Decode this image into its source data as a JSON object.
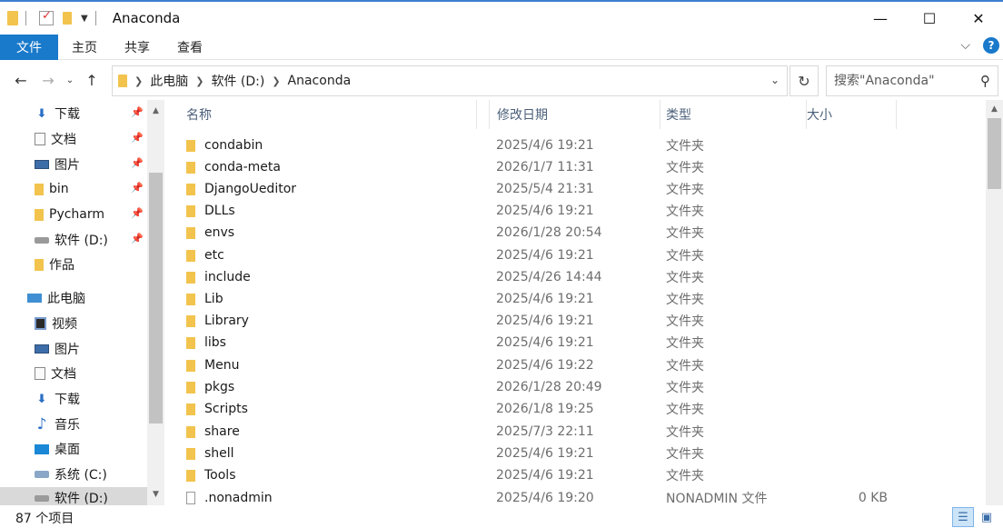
{
  "window": {
    "title": "Anaconda",
    "controls": {
      "minimize": "—",
      "maximize": "☐",
      "close": "✕"
    }
  },
  "ribbon": {
    "tabs": [
      "文件",
      "主页",
      "共享",
      "查看"
    ],
    "help": "?"
  },
  "nav": {
    "crumbs": [
      "此电脑",
      "软件 (D:)",
      "Anaconda"
    ],
    "search_placeholder": "搜索\"Anaconda\""
  },
  "sidebar": {
    "items": [
      {
        "label": "下载",
        "icon": "download-icon",
        "pinned": true
      },
      {
        "label": "文档",
        "icon": "document-icon",
        "pinned": true
      },
      {
        "label": "图片",
        "icon": "picture-icon",
        "pinned": true
      },
      {
        "label": "bin",
        "icon": "folder-icon",
        "pinned": true
      },
      {
        "label": "Pycharm",
        "icon": "folder-icon",
        "pinned": true
      },
      {
        "label": "软件 (D:)",
        "icon": "drive-icon",
        "pinned": true
      },
      {
        "label": "作品",
        "icon": "folder-icon",
        "pinned": false
      },
      {
        "label": "此电脑",
        "icon": "computer-icon",
        "pinned": false
      },
      {
        "label": "视频",
        "icon": "video-icon",
        "pinned": false
      },
      {
        "label": "图片",
        "icon": "picture-icon",
        "pinned": false
      },
      {
        "label": "文档",
        "icon": "document-icon",
        "pinned": false
      },
      {
        "label": "下载",
        "icon": "download-icon",
        "pinned": false
      },
      {
        "label": "音乐",
        "icon": "music-icon",
        "pinned": false
      },
      {
        "label": "桌面",
        "icon": "desktop-icon",
        "pinned": false
      },
      {
        "label": "系统 (C:)",
        "icon": "system-drive-icon",
        "pinned": false
      },
      {
        "label": "软件 (D:)",
        "icon": "drive-icon",
        "pinned": false,
        "selected": true
      }
    ]
  },
  "columns": {
    "name": "名称",
    "date": "修改日期",
    "type": "类型",
    "size": "大小"
  },
  "files": [
    {
      "name": "condabin",
      "date": "2025/4/6 19:21",
      "type": "文件夹",
      "size": "",
      "kind": "folder"
    },
    {
      "name": "conda-meta",
      "date": "2026/1/7 11:31",
      "type": "文件夹",
      "size": "",
      "kind": "folder"
    },
    {
      "name": "DjangoUeditor",
      "date": "2025/5/4 21:31",
      "type": "文件夹",
      "size": "",
      "kind": "folder"
    },
    {
      "name": "DLLs",
      "date": "2025/4/6 19:21",
      "type": "文件夹",
      "size": "",
      "kind": "folder"
    },
    {
      "name": "envs",
      "date": "2026/1/28 20:54",
      "type": "文件夹",
      "size": "",
      "kind": "folder"
    },
    {
      "name": "etc",
      "date": "2025/4/6 19:21",
      "type": "文件夹",
      "size": "",
      "kind": "folder"
    },
    {
      "name": "include",
      "date": "2025/4/26 14:44",
      "type": "文件夹",
      "size": "",
      "kind": "folder"
    },
    {
      "name": "Lib",
      "date": "2025/4/6 19:21",
      "type": "文件夹",
      "size": "",
      "kind": "folder"
    },
    {
      "name": "Library",
      "date": "2025/4/6 19:21",
      "type": "文件夹",
      "size": "",
      "kind": "folder"
    },
    {
      "name": "libs",
      "date": "2025/4/6 19:21",
      "type": "文件夹",
      "size": "",
      "kind": "folder"
    },
    {
      "name": "Menu",
      "date": "2025/4/6 19:22",
      "type": "文件夹",
      "size": "",
      "kind": "folder"
    },
    {
      "name": "pkgs",
      "date": "2026/1/28 20:49",
      "type": "文件夹",
      "size": "",
      "kind": "folder"
    },
    {
      "name": "Scripts",
      "date": "2026/1/8 19:25",
      "type": "文件夹",
      "size": "",
      "kind": "folder"
    },
    {
      "name": "share",
      "date": "2025/7/3 22:11",
      "type": "文件夹",
      "size": "",
      "kind": "folder"
    },
    {
      "name": "shell",
      "date": "2025/4/6 19:21",
      "type": "文件夹",
      "size": "",
      "kind": "folder"
    },
    {
      "name": "Tools",
      "date": "2025/4/6 19:21",
      "type": "文件夹",
      "size": "",
      "kind": "folder"
    },
    {
      "name": ".nonadmin",
      "date": "2025/4/6 19:20",
      "type": "NONADMIN 文件",
      "size": "0 KB",
      "kind": "file"
    }
  ],
  "status": {
    "count": "87 个项目"
  },
  "colors": {
    "accent": "#1979ca",
    "folder": "#f2c44e",
    "header_text": "#4c607a"
  }
}
